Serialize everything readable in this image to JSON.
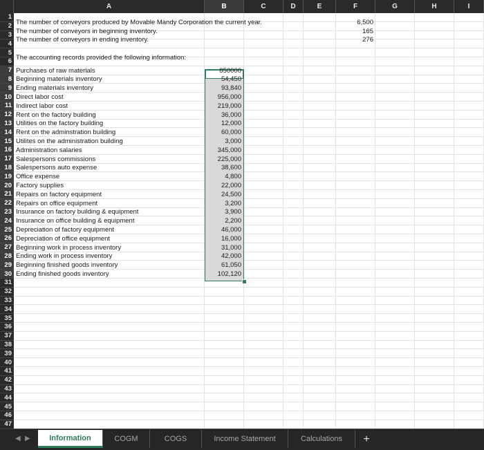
{
  "columns": [
    "A",
    "B",
    "C",
    "D",
    "E",
    "F",
    "G",
    "H",
    "I"
  ],
  "rows": [
    "1",
    "2",
    "3",
    "4",
    "5",
    "6",
    "7",
    "8",
    "9",
    "10",
    "11",
    "12",
    "13",
    "14",
    "15",
    "16",
    "17",
    "18",
    "19",
    "20",
    "21",
    "22",
    "23",
    "24",
    "25",
    "26",
    "27",
    "28",
    "29",
    "30",
    "31",
    "32",
    "33",
    "34",
    "35",
    "36",
    "37",
    "38",
    "39",
    "40",
    "41",
    "42",
    "43",
    "44",
    "45",
    "46",
    "47"
  ],
  "header_cells": {
    "r1": {
      "text": "The number of conveyors produced by Movable Mandy Corporation the current year.",
      "value": "6,500"
    },
    "r2": {
      "text": "The number of conveyors in beginning inventory.",
      "value": "165"
    },
    "r3": {
      "text": "The number of conveyors in ending inventory.",
      "value": "276"
    },
    "r5": {
      "text": "The accounting records provided the following information:"
    }
  },
  "records": [
    {
      "label": "Purchases of raw materials",
      "value": "850000"
    },
    {
      "label": "Beginning materials inventory",
      "value": "54,450"
    },
    {
      "label": "Ending materials inventory",
      "value": "93,840"
    },
    {
      "label": "Direct labor cost",
      "value": "956,000"
    },
    {
      "label": "Indirect labor cost",
      "value": "219,000"
    },
    {
      "label": "Rent on the factory building",
      "value": "36,000"
    },
    {
      "label": "Utilities on the factory building",
      "value": "12,000"
    },
    {
      "label": "Rent on the adminstration building",
      "value": "60,000"
    },
    {
      "label": "Utilites on the administration building",
      "value": "3,000"
    },
    {
      "label": "Administration salaries",
      "value": "345,000"
    },
    {
      "label": "Salespersons commissions",
      "value": "225,000"
    },
    {
      "label": "Salespersons auto expense",
      "value": "38,600"
    },
    {
      "label": "Office expense",
      "value": "4,800"
    },
    {
      "label": "Factory supplies",
      "value": "22,000"
    },
    {
      "label": "Repairs on factory equipment",
      "value": "24,500"
    },
    {
      "label": "Repairs on office equipment",
      "value": "3,200"
    },
    {
      "label": "Insurance on factory building & equipment",
      "value": "3,900"
    },
    {
      "label": "Insurance on office building & equipment",
      "value": "2,200"
    },
    {
      "label": "Depreciation of factory equipment",
      "value": "46,000"
    },
    {
      "label": "Depreciation of office equipment",
      "value": "16,000"
    },
    {
      "label": "Beginning work in process inventory",
      "value": "31,000"
    },
    {
      "label": "Ending work in process inventory",
      "value": "42,000"
    },
    {
      "label": "Beginning finished goods inventory",
      "value": "61,050"
    },
    {
      "label": "Ending finished goods inventory",
      "value": "102,120"
    }
  ],
  "tabs": [
    "Information",
    "COGM",
    "COGS",
    "Income Statement",
    "Calculations"
  ],
  "active_tab": "Information",
  "icons": {
    "prev": "nav-left-icon",
    "next": "nav-right-icon",
    "add": "plus-icon"
  },
  "colors": {
    "accent": "#2e7d5b",
    "selection_fill": "#d9d9d9",
    "header_bg": "#2a2a2a"
  }
}
